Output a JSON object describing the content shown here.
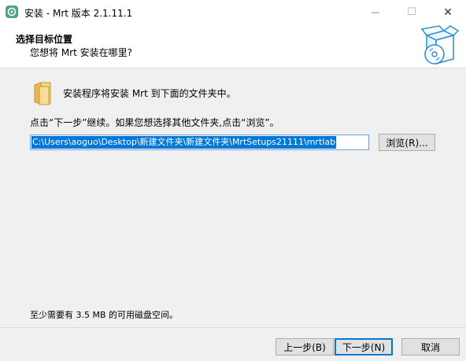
{
  "window": {
    "title": "安装 - Mrt 版本 2.1.11.1",
    "minimize_glyph": "—",
    "maximize_glyph": "☐",
    "close_glyph": "✕"
  },
  "header": {
    "title": "选择目标位置",
    "subtitle": "您想将 Mrt 安装在哪里?",
    "graphic_icon": "install-box-cd-icon"
  },
  "content": {
    "folder_icon": "folder-icon",
    "intro": "安装程序将安装 Mrt 到下面的文件夹中。",
    "instruction": "点击“下一步”继续。如果您想选择其他文件夹,点击“浏览”。",
    "path_value": "C:\\Users\\aoguo\\Desktop\\新建文件夹\\新建文件夹\\MrtSetups21111\\mrtlab",
    "browse_label": "浏览(R)...",
    "space_required": "至少需要有 3.5 MB 的可用磁盘空间。"
  },
  "footer": {
    "back_label": "上一步(B)",
    "next_label": "下一步(N)",
    "cancel_label": "取消"
  }
}
